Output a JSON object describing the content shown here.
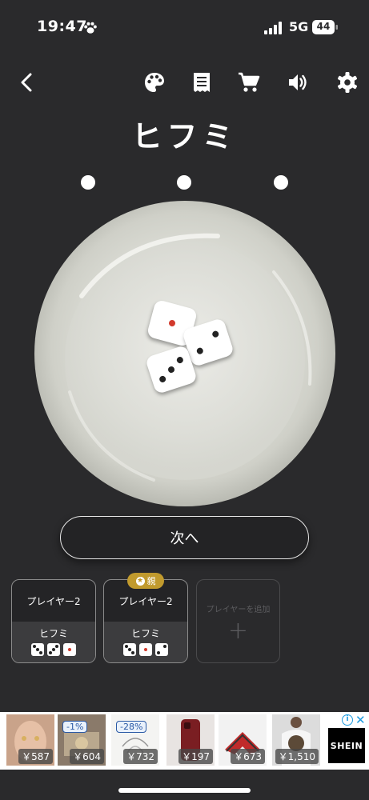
{
  "status_bar": {
    "time": "19:47",
    "network": "5G",
    "battery": "44"
  },
  "toolbar": {
    "icons": [
      "back-arrow-icon",
      "palette-icon",
      "receipt-icon",
      "cart-icon",
      "volume-icon",
      "gear-icon"
    ]
  },
  "game": {
    "title": "ヒフミ",
    "round_indicators": 3,
    "dice": [
      1,
      2,
      3
    ]
  },
  "next_button": {
    "label": "次へ"
  },
  "players": [
    {
      "name": "プレイヤー2",
      "hand": "ヒフミ",
      "dice": [
        3,
        3,
        1
      ],
      "is_parent": false
    },
    {
      "name": "プレイヤー2",
      "hand": "ヒフミ",
      "dice": [
        3,
        1,
        2
      ],
      "is_parent": true,
      "badge": "親"
    }
  ],
  "add_player": {
    "label": "プレイヤーを追加",
    "icon": "+"
  },
  "ad": {
    "prices": [
      "￥587",
      "￥604",
      "￥732",
      "￥197",
      "￥673",
      "￥1,510"
    ],
    "discounts": [
      "-1%",
      "-28%"
    ],
    "brand": "SHEIN"
  },
  "colors": {
    "background": "#2a2a2c",
    "red_pip": "#d23a2c",
    "badge": "#c19a2d"
  }
}
